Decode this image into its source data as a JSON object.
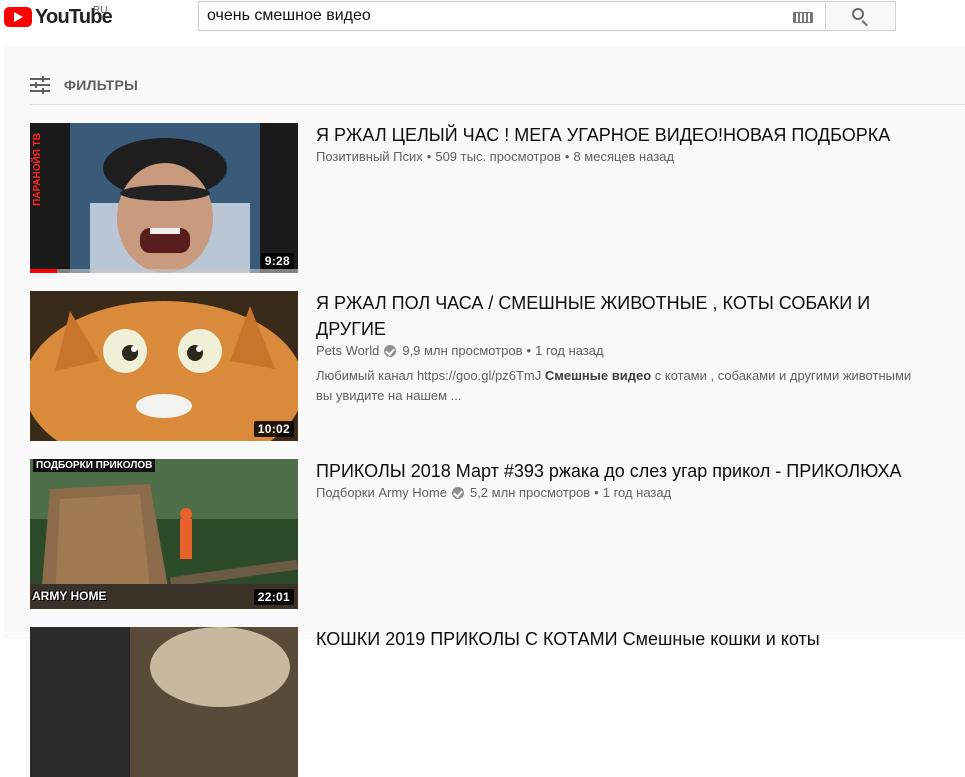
{
  "header": {
    "logo_text": "YouTube",
    "region": "RU",
    "search_value": "очень смешное видео",
    "keyboard_icon": "keyboard-icon",
    "search_icon": "search-icon"
  },
  "filters": {
    "label": "ФИЛЬТРЫ",
    "icon": "filter-icon"
  },
  "results": [
    {
      "title": "Я РЖАЛ ЦЕЛЫЙ ЧАС ! МЕГА УГАРНОЕ ВИДЕО!НОВАЯ ПОДБОРКА",
      "channel": "Позитивный Псих",
      "views": "509 тыс. просмотров",
      "age": "8 месяцев назад",
      "duration": "9:28",
      "thumb_label": "ПАРАНОЙЯ ТВ",
      "watched_fraction": 0.1
    },
    {
      "title": "Я РЖАЛ ПОЛ ЧАСА / СМЕШНЫЕ ЖИВОТНЫЕ , КОТЫ СОБАКИ И ДРУГИЕ",
      "channel": "Pets World",
      "verified": true,
      "views": "9,9 млн просмотров",
      "age": "1 год назад",
      "duration": "10:02",
      "desc_prefix": "Любимый канал https://goo.gl/pz6TmJ ",
      "desc_bold": "Смешные видео",
      "desc_suffix": " с котами , собаками и другими животными вы увидите на нашем ..."
    },
    {
      "title": "ПРИКОЛЫ 2018 Март #393 ржака до слез угар прикол - ПРИКОЛЮХА",
      "channel": "Подборки Army Home",
      "verified": true,
      "views": "5,2 млн просмотров",
      "age": "1 год назад",
      "duration": "22:01",
      "thumb_badge": "ПОДБОРКИ ПРИКОЛОВ",
      "thumb_brand": "ARMY HOME"
    },
    {
      "title": "КОШКИ 2019 ПРИКОЛЫ С КОТАМИ Смешные кошки и коты"
    }
  ],
  "colors": {
    "brand": "#ff0000",
    "meta": "#606060",
    "panel": "#f9f9f9"
  }
}
